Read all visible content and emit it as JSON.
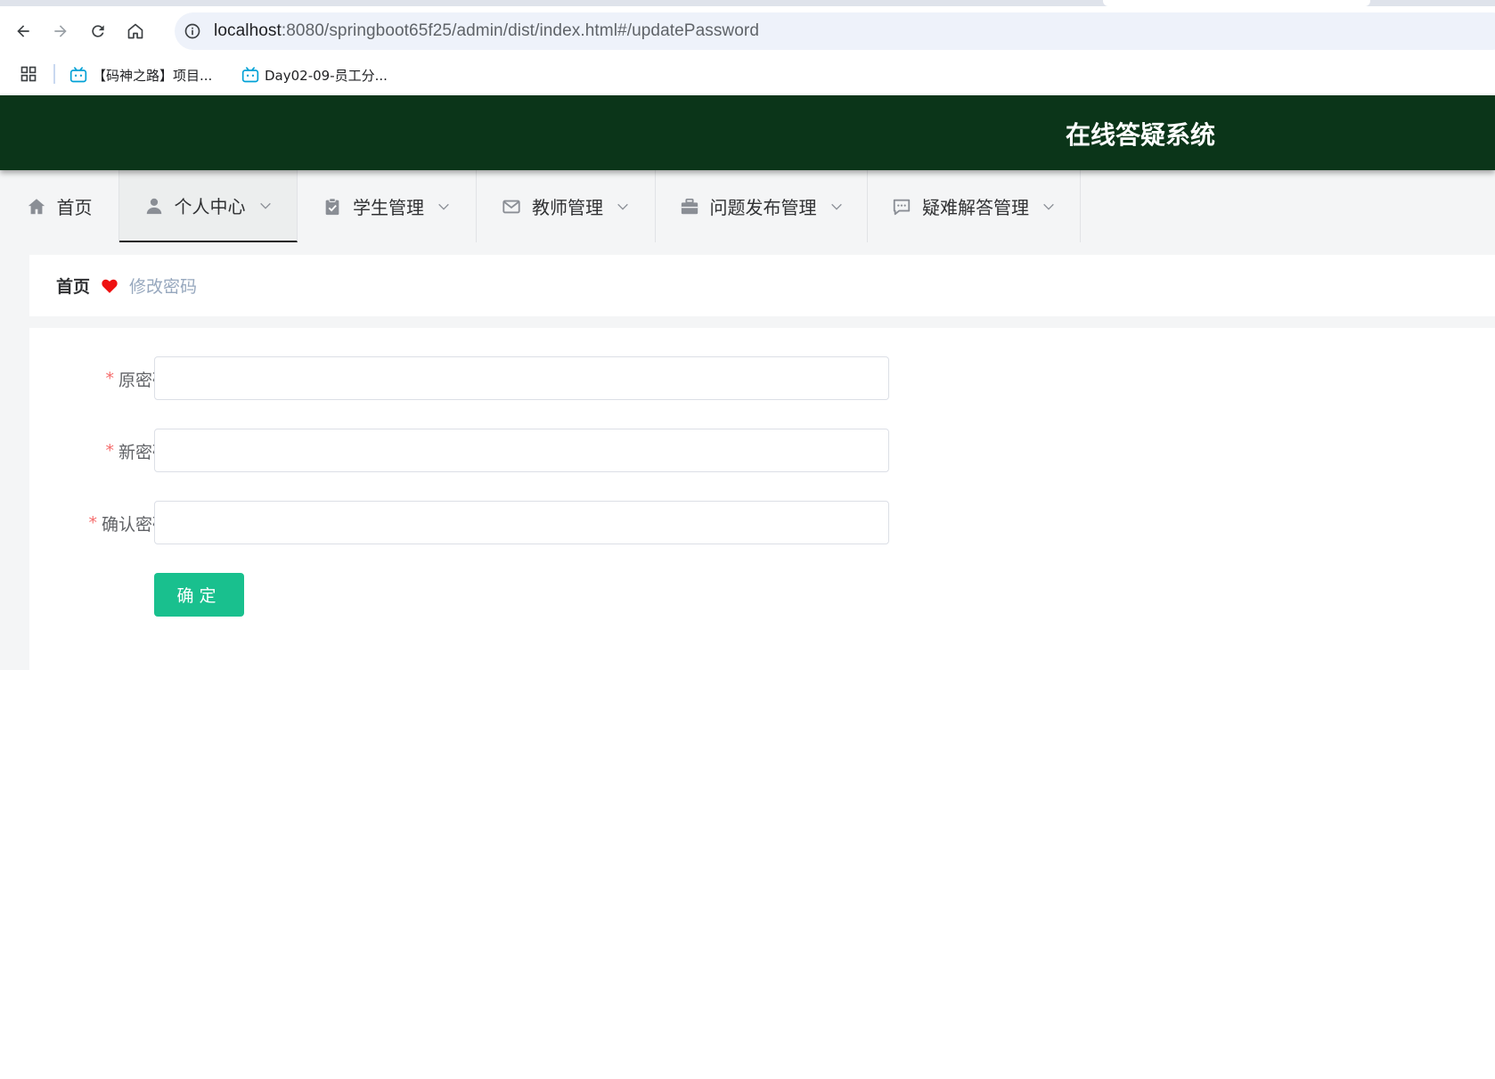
{
  "browser": {
    "url_host": "localhost",
    "url_rest": ":8080/springboot65f25/admin/dist/index.html#/updatePassword",
    "bookmarks": [
      {
        "label": "【码神之路】项目..."
      },
      {
        "label": "Day02-09-员工分..."
      }
    ]
  },
  "header": {
    "title": "在线答疑系统"
  },
  "menu": {
    "items": [
      {
        "label": "首页",
        "icon": "home-icon"
      },
      {
        "label": "个人中心",
        "icon": "user-icon"
      },
      {
        "label": "学生管理",
        "icon": "clipboard-check-icon"
      },
      {
        "label": "教师管理",
        "icon": "mail-icon"
      },
      {
        "label": "问题发布管理",
        "icon": "briefcase-icon"
      },
      {
        "label": "疑难解答管理",
        "icon": "chat-icon"
      }
    ],
    "active": "个人中心"
  },
  "breadcrumb": {
    "home": "首页",
    "current": "修改密码"
  },
  "form": {
    "required_mark": "*",
    "fields": [
      {
        "label": "原密码",
        "value": ""
      },
      {
        "label": "新密码",
        "value": ""
      },
      {
        "label": "确认密码",
        "value": ""
      }
    ],
    "submit_label": "确定"
  },
  "colors": {
    "header_bg": "#0b3519",
    "primary_button": "#19c08e",
    "required": "#f56c6c",
    "breadcrumb_current": "#97a8be",
    "heart": "#ee1111"
  }
}
